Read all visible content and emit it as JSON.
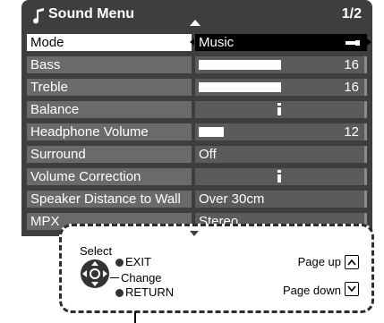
{
  "header": {
    "title": "Sound Menu",
    "page": "1/2",
    "icon": "music-note-icon"
  },
  "rows": [
    {
      "label": "Mode",
      "value": "Music",
      "selected": true
    },
    {
      "label": "Bass",
      "value": "16",
      "bar_fraction": 0.5
    },
    {
      "label": "Treble",
      "value": "16",
      "bar_fraction": 0.5
    },
    {
      "label": "Balance",
      "value": "",
      "marker_fraction": 0.5
    },
    {
      "label": "Headphone Volume",
      "value": "12",
      "bar_fraction": 0.15
    },
    {
      "label": "Surround",
      "value": "Off"
    },
    {
      "label": "Volume Correction",
      "value": "",
      "marker_fraction": 0.5
    },
    {
      "label": "Speaker Distance to Wall",
      "value": "Over 30cm"
    },
    {
      "label": "MPX",
      "value": "Stereo"
    }
  ],
  "guide": {
    "select": "Select",
    "exit": "EXIT",
    "change": "Change",
    "return": "RETURN",
    "page_up": "Page up",
    "page_down": "Page down"
  },
  "colors": {
    "panel": "#3e3e3e",
    "label_bg": "#6a6a6a",
    "value_bg": "#5b5b5b",
    "selected_label": "#ffffff",
    "selected_value": "#000000"
  }
}
